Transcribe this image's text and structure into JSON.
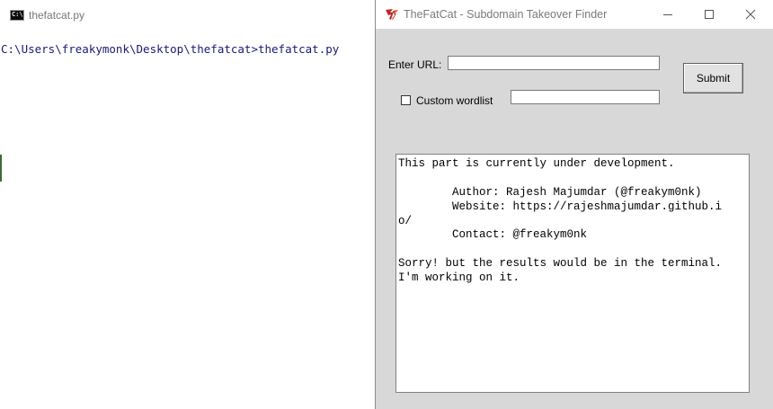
{
  "console": {
    "title": "thefatcat.py",
    "prompt_line": "C:\\Users\\freakymonk\\Desktop\\thefatcat>thefatcat.py",
    "icon": "cmd-icon",
    "icon_text": "C:\\"
  },
  "tk_window": {
    "title": "TheFatCat - Subdomain Takeover Finder",
    "icon": "tk-feather-icon",
    "controls": {
      "minimize": "minimize-icon",
      "maximize": "maximize-icon",
      "close": "close-icon"
    }
  },
  "form": {
    "url_label": "Enter URL:",
    "url_value": "",
    "submit_label": "Submit",
    "custom_wordlist_label": "Custom wordlist",
    "custom_wordlist_checked": false,
    "wordlist_value": ""
  },
  "output": {
    "lines": [
      "This part is currently under development.",
      "",
      "        Author: Rajesh Majumdar (@freakym0nk)",
      "        Website: https://rajeshmajumdar.github.i",
      "o/",
      "        Contact: @freakym0nk",
      "",
      "Sorry! but the results would be in the terminal.",
      "I'm working on it."
    ]
  }
}
